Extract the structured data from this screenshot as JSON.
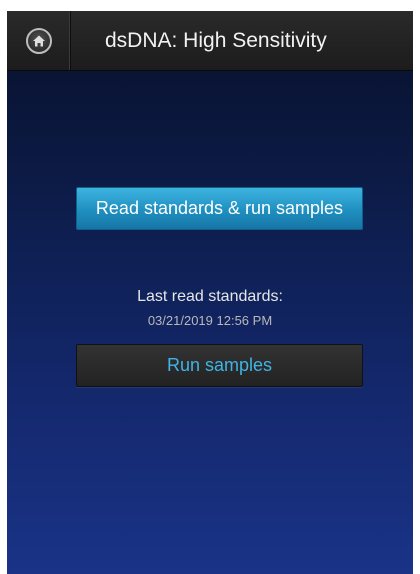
{
  "header": {
    "home_icon": "home-icon",
    "title": "dsDNA: High Sensitivity"
  },
  "main": {
    "read_standards_button": "Read standards & run samples",
    "last_read_label": "Last read standards:",
    "last_read_datetime": "03/21/2019 12:56 PM",
    "run_samples_button": "Run samples"
  },
  "colors": {
    "primary_button": "#2a9fd0",
    "accent_text": "#3fb4e6",
    "background_top": "#08102a",
    "background_bottom": "#1a3387"
  }
}
